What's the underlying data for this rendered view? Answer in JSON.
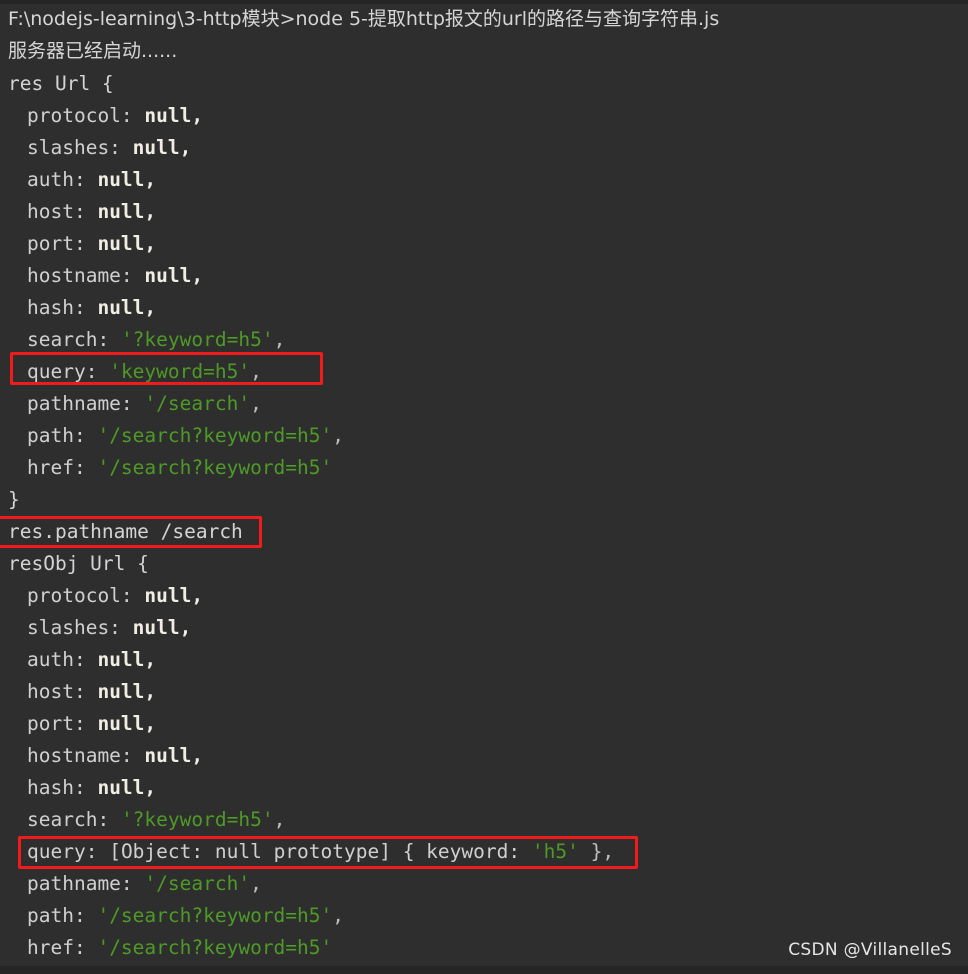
{
  "terminal": {
    "prompt_line": "F:\\nodejs-learning\\3-http模块>node 5-提取http报文的url的路径与查询字符串.js",
    "startup_line": "服务器已经启动......",
    "background_color": "#2e2e2e",
    "text_color": "#d4d4d4",
    "string_color": "#4e9a27",
    "highlight_color": "#f01c1c"
  },
  "blocks": [
    {
      "header": "res Url {",
      "footer": "}",
      "entries": [
        {
          "key": "protocol:",
          "value": "null,",
          "type": "null"
        },
        {
          "key": "slashes:",
          "value": "null,",
          "type": "null"
        },
        {
          "key": "auth:",
          "value": "null,",
          "type": "null"
        },
        {
          "key": "host:",
          "value": "null,",
          "type": "null"
        },
        {
          "key": "port:",
          "value": "null,",
          "type": "null"
        },
        {
          "key": "hostname:",
          "value": "null,",
          "type": "null"
        },
        {
          "key": "hash:",
          "value": "null,",
          "type": "null"
        },
        {
          "key": "search:",
          "value": "'?keyword=h5'",
          "type": "string",
          "trail": ","
        },
        {
          "key": "query:",
          "value": "'keyword=h5'",
          "type": "string",
          "trail": ",",
          "highlighted": true
        },
        {
          "key": "pathname:",
          "value": "'/search'",
          "type": "string",
          "trail": ","
        },
        {
          "key": "path:",
          "value": "'/search?keyword=h5'",
          "type": "string",
          "trail": ","
        },
        {
          "key": "href:",
          "value": "'/search?keyword=h5'",
          "type": "string",
          "trail": ""
        }
      ]
    },
    {
      "header": "resObj Url {",
      "footer": "",
      "entries": [
        {
          "key": "protocol:",
          "value": "null,",
          "type": "null"
        },
        {
          "key": "slashes:",
          "value": "null,",
          "type": "null"
        },
        {
          "key": "auth:",
          "value": "null,",
          "type": "null"
        },
        {
          "key": "host:",
          "value": "null,",
          "type": "null"
        },
        {
          "key": "port:",
          "value": "null,",
          "type": "null"
        },
        {
          "key": "hostname:",
          "value": "null,",
          "type": "null"
        },
        {
          "key": "hash:",
          "value": "null,",
          "type": "null"
        },
        {
          "key": "search:",
          "value": "'?keyword=h5'",
          "type": "string",
          "trail": ","
        },
        {
          "key": "query:",
          "value": "[Object: null prototype] { keyword: 'h5' },",
          "type": "object",
          "highlighted": true
        },
        {
          "key": "pathname:",
          "value": "'/search'",
          "type": "string",
          "trail": ","
        },
        {
          "key": "path:",
          "value": "'/search?keyword=h5'",
          "type": "string",
          "trail": ","
        },
        {
          "key": "href:",
          "value": "'/search?keyword=h5'",
          "type": "string",
          "trail": ""
        }
      ]
    }
  ],
  "log_line": {
    "label": "res.pathname",
    "value": "/search",
    "full": "res.pathname /search"
  },
  "object_query_line": {
    "key": "query:",
    "prefix": "[Object: null prototype] { keyword:",
    "string": "'h5'",
    "suffix": "},"
  },
  "watermark": "CSDN @VillanelleS"
}
